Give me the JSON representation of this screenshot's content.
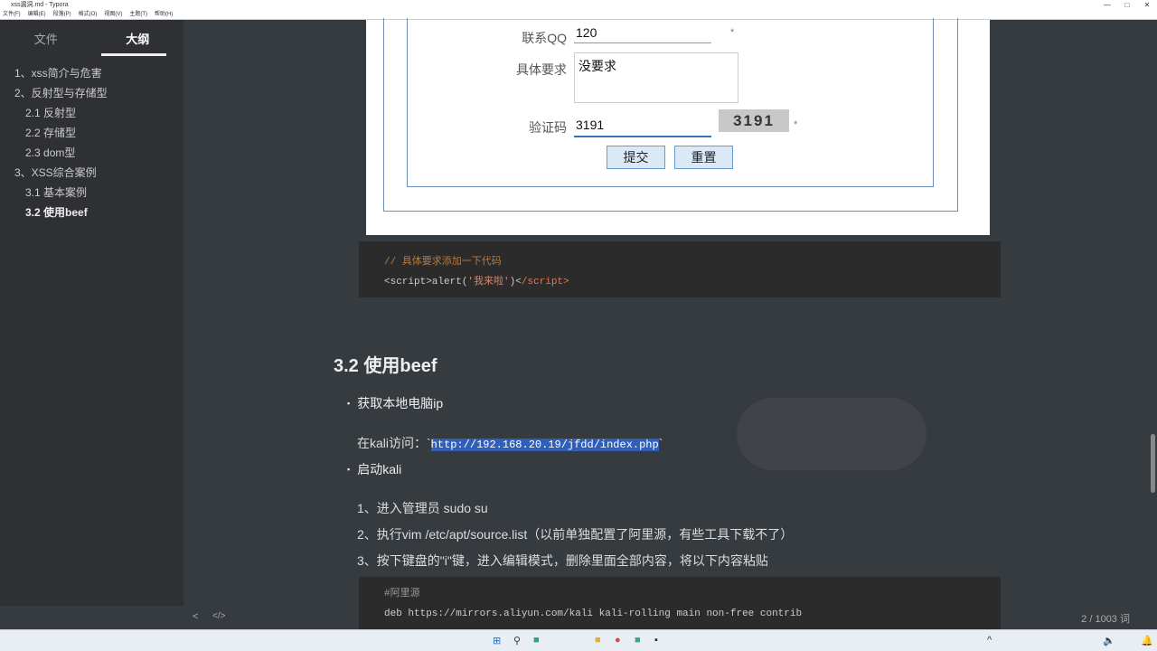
{
  "window": {
    "title": "xss漏洞.md - Typora",
    "minimize": "—",
    "maximize": "□",
    "close": "✕"
  },
  "menu": [
    "文件(F)",
    "编辑(E)",
    "段落(P)",
    "格式(O)",
    "视图(V)",
    "主题(T)",
    "帮助(H)"
  ],
  "sidebar": {
    "tabs": [
      "文件",
      "大纲"
    ],
    "outline": [
      {
        "label": "1、xss简介与危害",
        "level": 1
      },
      {
        "label": "2、反射型与存储型",
        "level": 1
      },
      {
        "label": "2.1 反射型",
        "level": 2
      },
      {
        "label": "2.2 存储型",
        "level": 2
      },
      {
        "label": "2.3 dom型",
        "level": 2
      },
      {
        "label": "3、XSS综合案例",
        "level": 1
      },
      {
        "label": "3.1 基本案例",
        "level": 2
      },
      {
        "label": "3.2 使用beef",
        "level": 2
      }
    ]
  },
  "form": {
    "qq_label": "联系QQ",
    "qq_value": "120",
    "req_label": "具体要求",
    "req_value": "没要求",
    "captcha_label": "验证码",
    "captcha_value": "3191",
    "captcha_image": "3191",
    "star": "*",
    "submit": "提交",
    "reset": "重置"
  },
  "code1": {
    "comment": "// 具体要求添加一下代码",
    "line_pre": "<script>alert(",
    "line_str": "'我来啦'",
    "line_post": ")<",
    "line_end": "/script>"
  },
  "heading": "3.2 使用beef",
  "bullet1": "获取本地电脑ip",
  "kali_access_label": "在kali访问：`",
  "kali_url": "http://192.168.20.19/jfdd/index.php",
  "kali_tick": "`",
  "bullet2": "启动kali",
  "steps": [
    "1、进入管理员 sudo su",
    "2、执行vim /etc/apt/source.list（以前单独配置了阿里源，有些工具下载不了）",
    "3、按下键盘的\"i\"键，进入编辑模式，删除里面全部内容，将以下内容粘贴"
  ],
  "code2": {
    "comment": "#阿里源",
    "line": "deb https://mirrors.aliyun.com/kali kali-rolling main non-free contrib"
  },
  "status": {
    "back": "<",
    "source": "</>",
    "words": "2 / 1003 词"
  }
}
